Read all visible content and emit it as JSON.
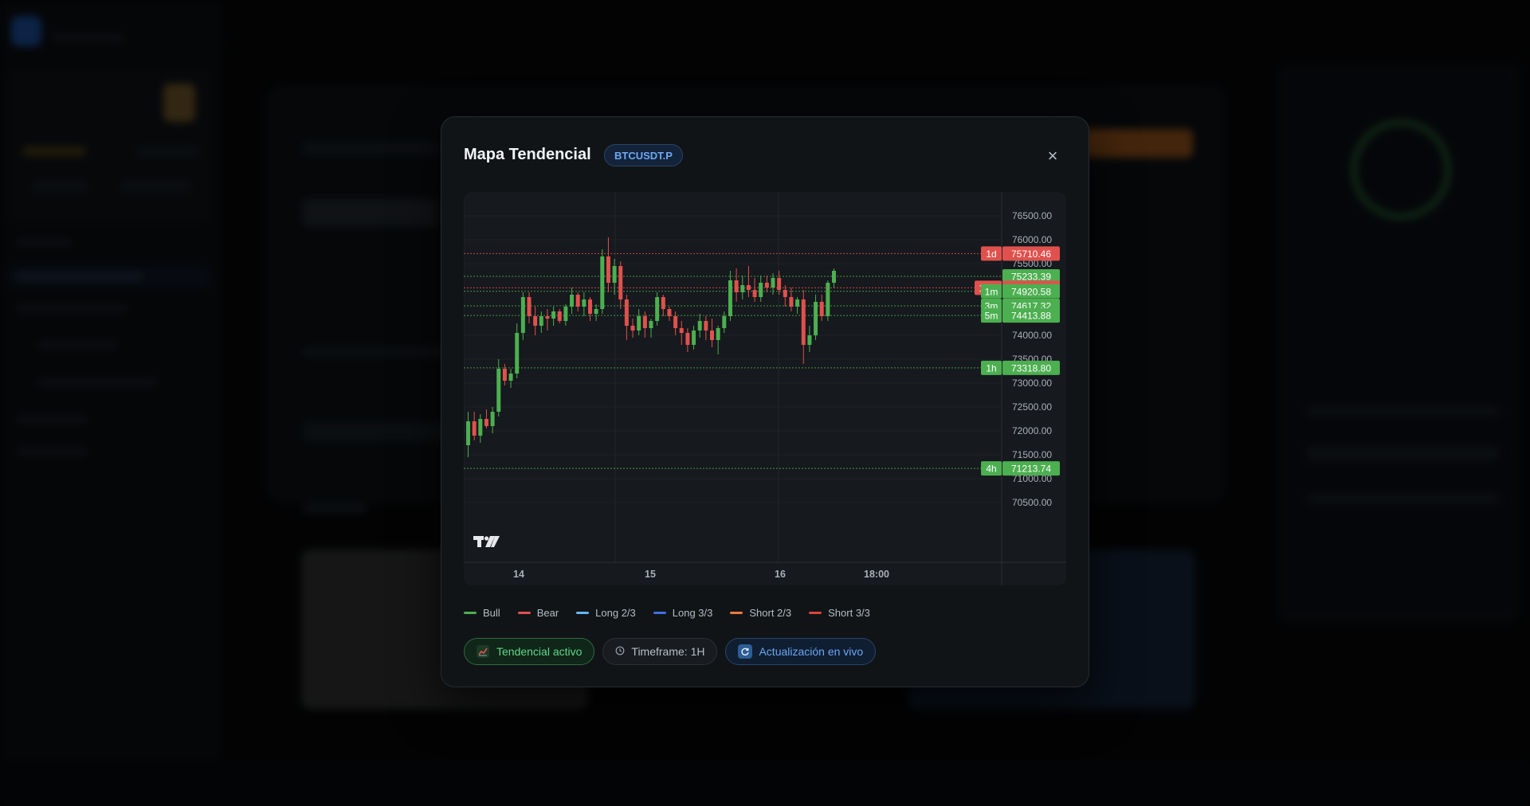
{
  "modal": {
    "title": "Mapa Tendencial",
    "symbol": "BTCUSDT.P",
    "close_label": "×"
  },
  "legend": [
    {
      "label": "Bull",
      "color": "#4caf50"
    },
    {
      "label": "Bear",
      "color": "#e0514d"
    },
    {
      "label": "Long 2/3",
      "color": "#64b5f6"
    },
    {
      "label": "Long 3/3",
      "color": "#3f6fe0"
    },
    {
      "label": "Short 2/3",
      "color": "#f07a3a"
    },
    {
      "label": "Short 3/3",
      "color": "#d9443e"
    }
  ],
  "chips": {
    "trend": "Tendencial activo",
    "timeframe": "Timeframe: 1H",
    "live": "Actualización en vivo"
  },
  "chart_data": {
    "type": "candlestick",
    "symbol": "BTCUSDT.P",
    "y_ticks": [
      "76500.00",
      "76000.00",
      "75500.00",
      "74000.00",
      "73500.00",
      "73000.00",
      "72500.00",
      "72000.00",
      "71500.00",
      "71000.00",
      "70500.00"
    ],
    "ylim": [
      70500,
      76700
    ],
    "x_ticks": [
      "14",
      "15",
      "16",
      "18:00"
    ],
    "colors": {
      "bull": "#4caf50",
      "bear": "#e0514d"
    },
    "levels": [
      {
        "tf": "1d",
        "price": "75710.46",
        "value": 75710.46,
        "color": "#e0514d"
      },
      {
        "tf": "",
        "price": "75233.39",
        "value": 75233.39,
        "color": "#4caf50"
      },
      {
        "tf": "15m",
        "price": "74993.35",
        "value": 74993.35,
        "color": "#e0514d"
      },
      {
        "tf": "1m",
        "price": "74920.58",
        "value": 74920.58,
        "color": "#4caf50"
      },
      {
        "tf": "3m",
        "price": "74617.32",
        "value": 74617.32,
        "color": "#4caf50"
      },
      {
        "tf": "5m",
        "price": "74413.88",
        "value": 74413.88,
        "color": "#4caf50"
      },
      {
        "tf": "1h",
        "price": "73318.80",
        "value": 73318.8,
        "color": "#4caf50"
      },
      {
        "tf": "4h",
        "price": "71213.74",
        "value": 71213.74,
        "color": "#4caf50"
      }
    ],
    "candles": [
      [
        71700,
        72400,
        71450,
        72200
      ],
      [
        72200,
        72400,
        71800,
        71900
      ],
      [
        71900,
        72350,
        71750,
        72250
      ],
      [
        72250,
        72450,
        72050,
        72100
      ],
      [
        72100,
        72500,
        71950,
        72400
      ],
      [
        72400,
        73500,
        72300,
        73300
      ],
      [
        73300,
        73400,
        72950,
        73050
      ],
      [
        73050,
        73300,
        72900,
        73200
      ],
      [
        73200,
        74250,
        73100,
        74050
      ],
      [
        74050,
        74900,
        73900,
        74800
      ],
      [
        74800,
        74900,
        74250,
        74400
      ],
      [
        74400,
        74600,
        74000,
        74200
      ],
      [
        74200,
        74500,
        74050,
        74400
      ],
      [
        74400,
        74550,
        74100,
        74350
      ],
      [
        74350,
        74600,
        74200,
        74500
      ],
      [
        74500,
        74550,
        74250,
        74300
      ],
      [
        74300,
        74650,
        74200,
        74600
      ],
      [
        74600,
        75000,
        74450,
        74850
      ],
      [
        74850,
        74900,
        74500,
        74600
      ],
      [
        74600,
        74900,
        74400,
        74750
      ],
      [
        74750,
        74800,
        74300,
        74450
      ],
      [
        74450,
        74650,
        74300,
        74550
      ],
      [
        74550,
        75800,
        74450,
        75650
      ],
      [
        75650,
        76050,
        74900,
        75100
      ],
      [
        75100,
        75600,
        74850,
        75450
      ],
      [
        75450,
        75550,
        74550,
        74750
      ],
      [
        74750,
        74850,
        73900,
        74200
      ],
      [
        74200,
        74350,
        73950,
        74100
      ],
      [
        74100,
        74550,
        74000,
        74400
      ],
      [
        74400,
        74500,
        73950,
        74150
      ],
      [
        74150,
        74350,
        73950,
        74300
      ],
      [
        74300,
        74900,
        74200,
        74800
      ],
      [
        74800,
        74850,
        74400,
        74550
      ],
      [
        74550,
        74600,
        74300,
        74400
      ],
      [
        74400,
        74500,
        74000,
        74150
      ],
      [
        74150,
        74300,
        73800,
        74050
      ],
      [
        74050,
        74150,
        73650,
        73800
      ],
      [
        73800,
        74200,
        73700,
        74100
      ],
      [
        74100,
        74450,
        73950,
        74300
      ],
      [
        74300,
        74400,
        73900,
        74100
      ],
      [
        74100,
        74350,
        73750,
        73900
      ],
      [
        73900,
        74200,
        73600,
        74150
      ],
      [
        74150,
        74500,
        74050,
        74400
      ],
      [
        74400,
        75350,
        74300,
        75150
      ],
      [
        75150,
        75400,
        74700,
        74900
      ],
      [
        74900,
        75250,
        74750,
        75050
      ],
      [
        75050,
        75450,
        74800,
        74950
      ],
      [
        74950,
        75200,
        74700,
        74800
      ],
      [
        74800,
        75250,
        74700,
        75100
      ],
      [
        75100,
        75250,
        74900,
        75000
      ],
      [
        75000,
        75300,
        74850,
        75200
      ],
      [
        75200,
        75350,
        74850,
        74950
      ],
      [
        74950,
        75050,
        74600,
        74800
      ],
      [
        74800,
        75000,
        74500,
        74600
      ],
      [
        74600,
        74800,
        74450,
        74750
      ],
      [
        74750,
        74950,
        73400,
        73800
      ],
      [
        73800,
        74200,
        73650,
        74000
      ],
      [
        74000,
        74850,
        73900,
        74700
      ],
      [
        74700,
        74850,
        74300,
        74400
      ],
      [
        74400,
        75150,
        74300,
        75100
      ],
      [
        75100,
        75400,
        75000,
        75350
      ]
    ]
  }
}
